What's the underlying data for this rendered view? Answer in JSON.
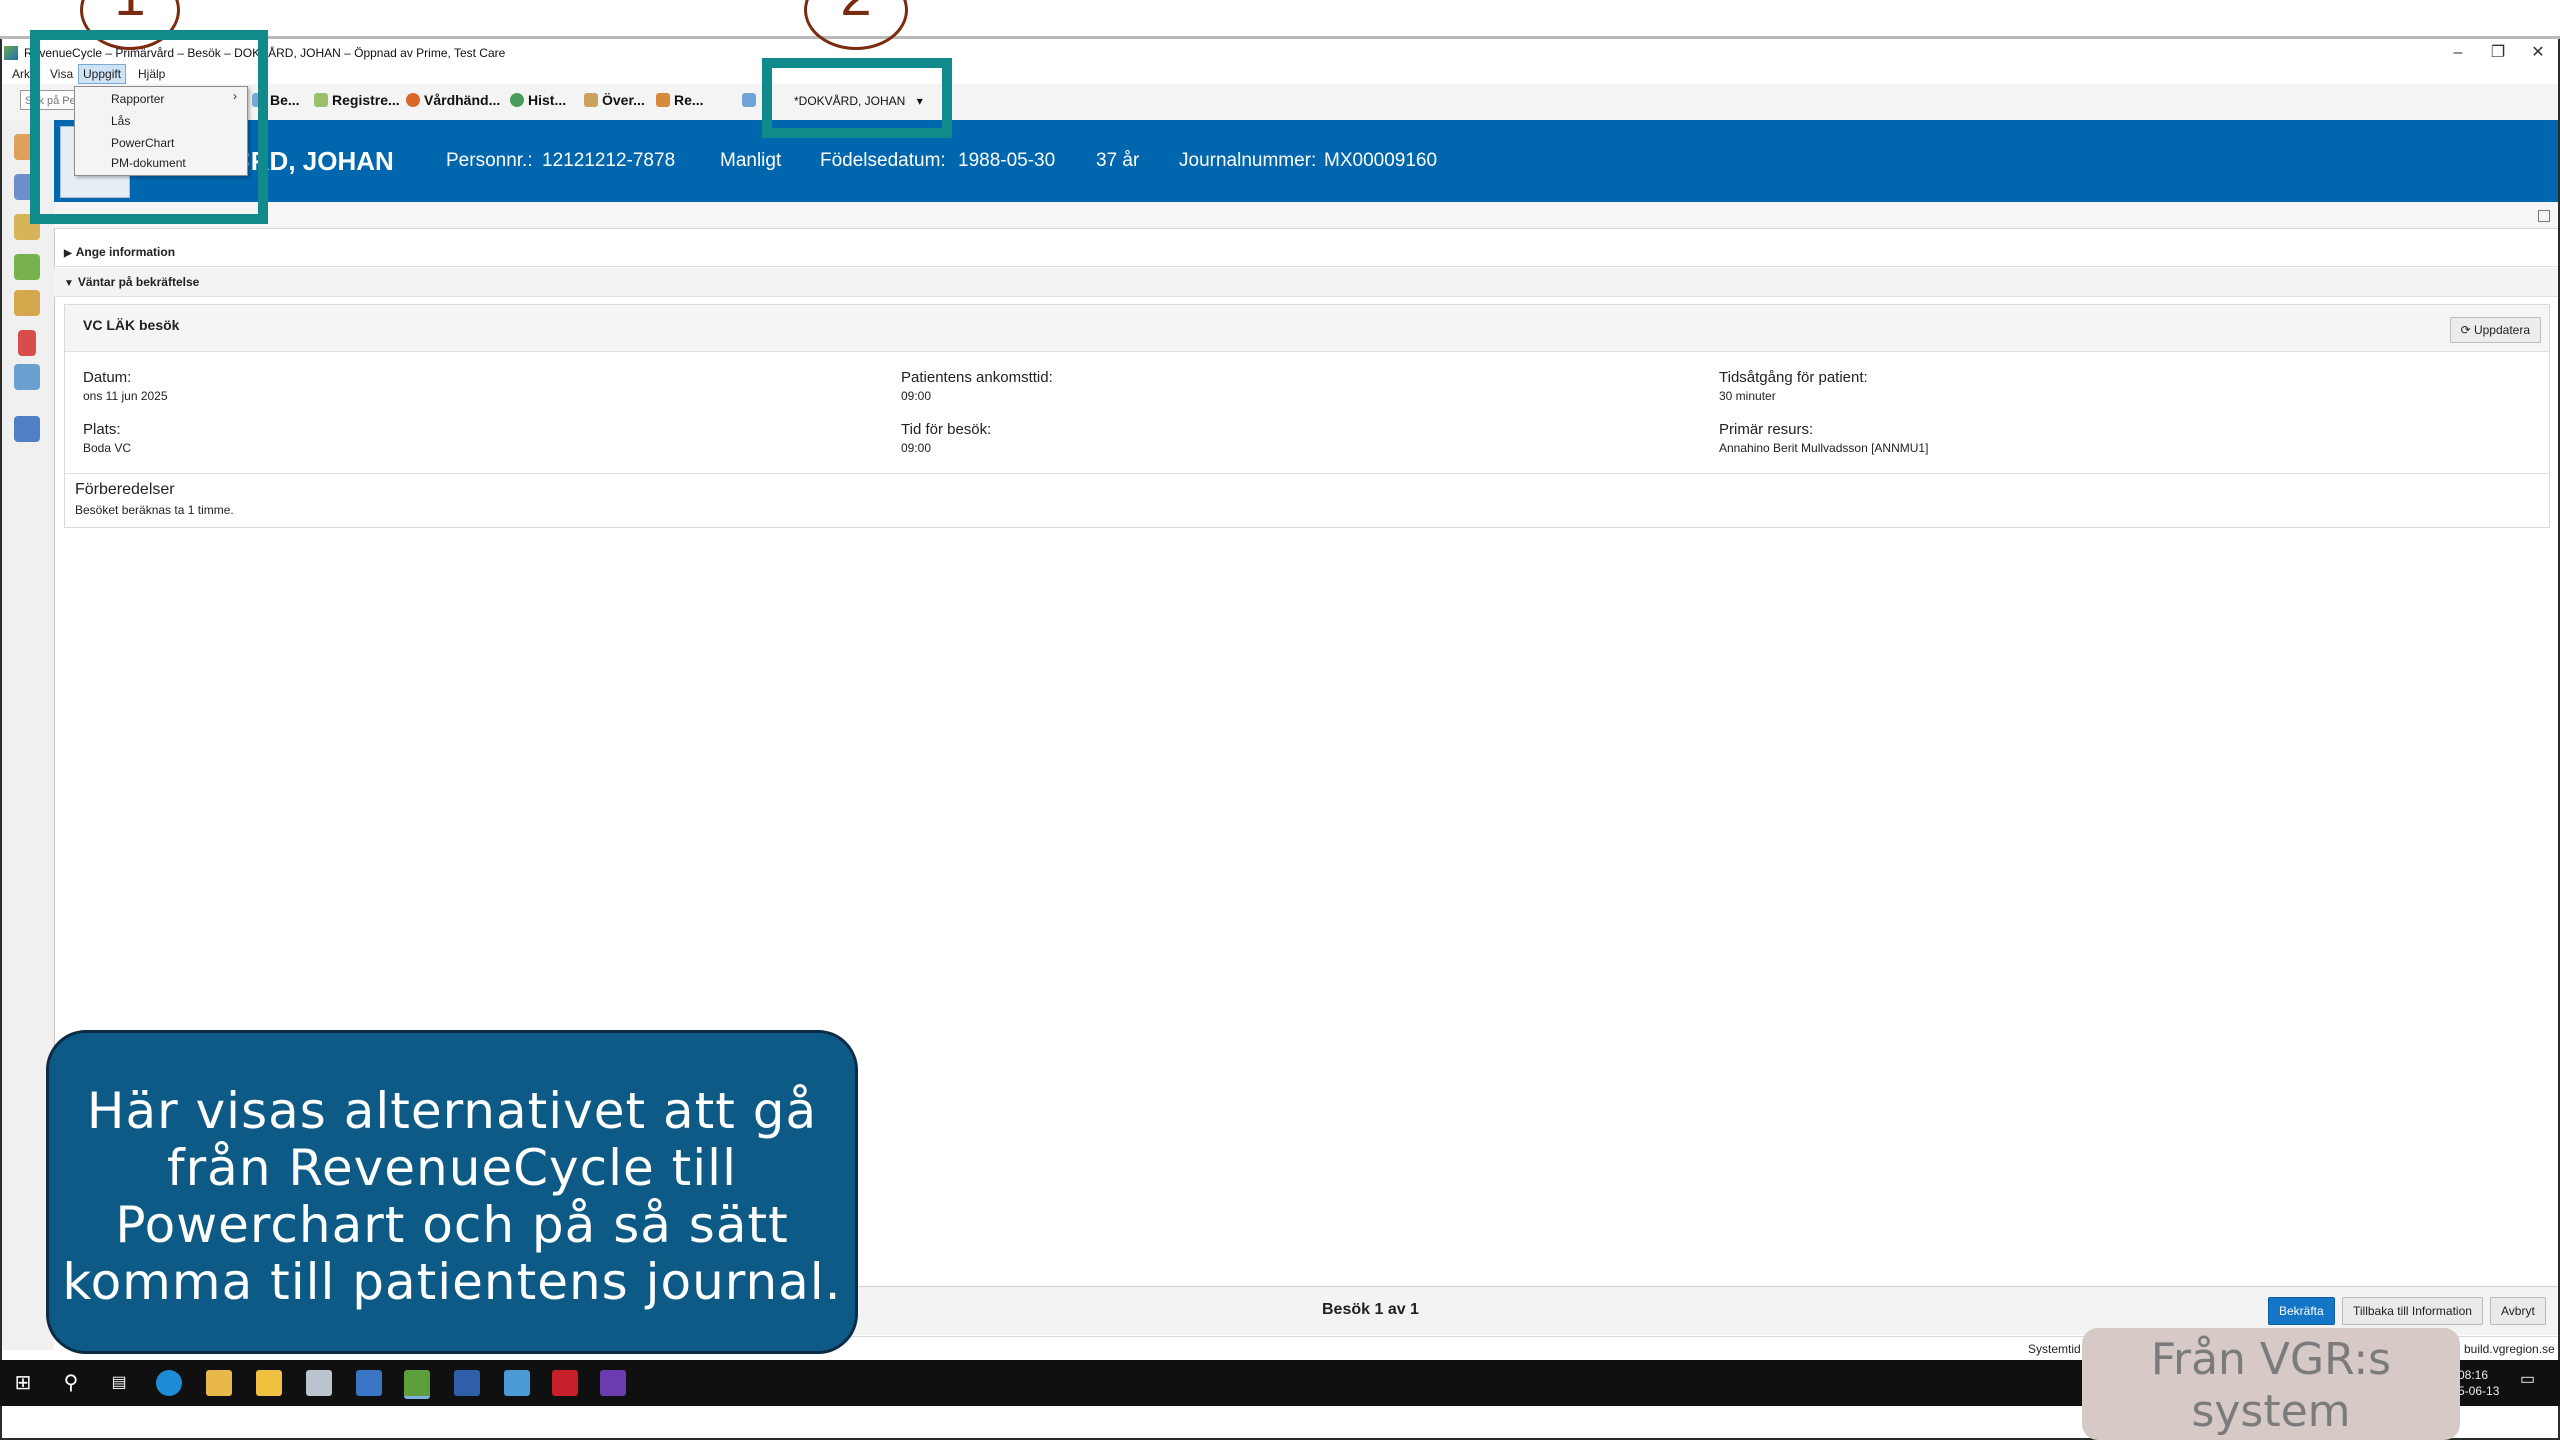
{
  "window": {
    "title": "RevenueCycle – Primärvård – Besök – DOKVÅRD, JOHAN – Öppnad av Prime, Test Care",
    "controls": [
      "–",
      "❐",
      "✕"
    ]
  },
  "menubar": {
    "items": [
      "Arkiv",
      "Visa",
      "Uppgift",
      "Hjälp"
    ],
    "active": "Uppgift"
  },
  "dropdown": {
    "items": [
      "Rapporter",
      "Lås",
      "PowerChart",
      "PM-dokument"
    ],
    "submenu_arrow": "›"
  },
  "toolbar": {
    "search_placeholder": "Sök på Pe",
    "buttons": [
      "Be...",
      "Registre...",
      "Vårdhänd...",
      "Hist...",
      "Över...",
      "Re..."
    ],
    "patient_selector": "*DOKVÅRD, JOHAN"
  },
  "banner": {
    "name": "DOKVÅRD, JOHAN",
    "name_visible": "∓RD, JOHAN",
    "personnr_label": "Personnr.:",
    "personnr": "12121212-7878",
    "gender": "Manligt",
    "dob_label": "Födelsedatum:",
    "dob": "1988-05-30",
    "age": "37 år",
    "journal_label": "Journalnummer:",
    "journal": "MX00009160"
  },
  "sections": {
    "info": "Ange information",
    "pending": "Väntar på bekräftelse"
  },
  "visit": {
    "title": "VC LÄK besök",
    "refresh_label": "Uppdatera",
    "date_label": "Datum:",
    "date": "ons 11 jun 2025",
    "arrival_label": "Patientens ankomsttid:",
    "arrival": "09:00",
    "duration_label": "Tidsåtgång för patient:",
    "duration": "30 minuter",
    "place_label": "Plats:",
    "place": "Boda VC",
    "time_label": "Tid för besök:",
    "time": "09:00",
    "resource_label": "Primär resurs:",
    "resource": "Annahino Berit Mullvadsson [ANNMU1]",
    "prep_label": "Förberedelser",
    "prep": "Besöket beräknas ta 1 timme."
  },
  "footer": {
    "visit_counter": "Besök 1 av 1",
    "confirm": "Bekräfta",
    "back": "Tillbaka till Information",
    "cancel": "Avbryt"
  },
  "statusbar": {
    "systemtid": "Systemtid",
    "server": "build.vgregion.se"
  },
  "tray": {
    "time": "08:16",
    "date": "5-06-13"
  },
  "annotations": {
    "step1": "1",
    "step2": "2",
    "callout": "Här visas alternativet att gå från RevenueCycle till Powerchart och på så sätt komma till patientens journal.",
    "source": "Från VGR:s system",
    "highlight_color": "#118a8c"
  },
  "colors": {
    "banner": "#0066ad",
    "callout_bg": "#0e5a86",
    "primary_button": "#1376c6"
  }
}
